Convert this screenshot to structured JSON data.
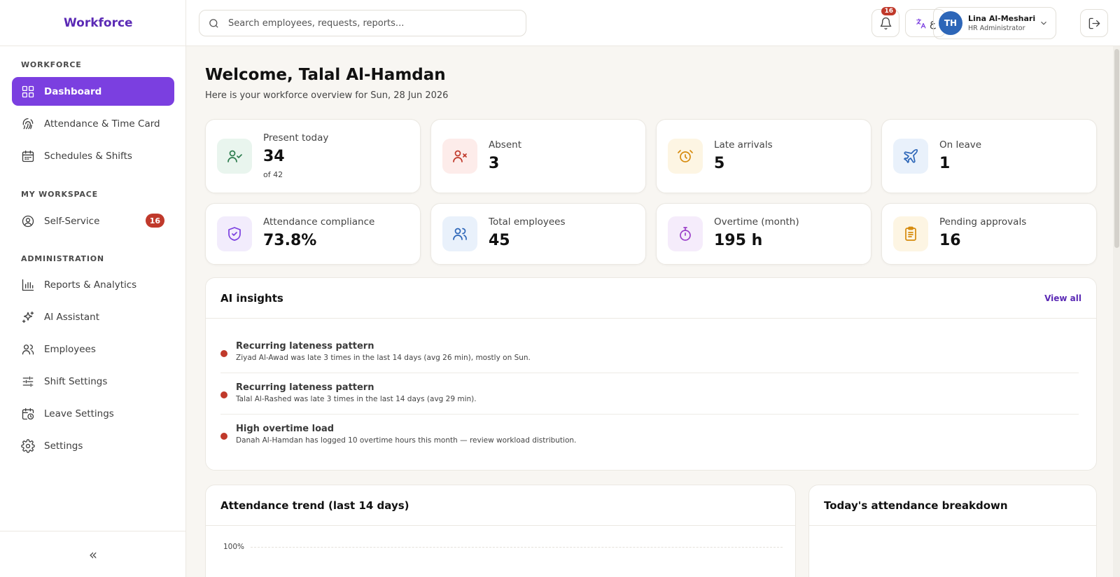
{
  "app": {
    "brand": "Workforce"
  },
  "sidebar": {
    "sections": [
      {
        "title": "WORKFORCE"
      },
      {
        "title": "MY WORKSPACE"
      },
      {
        "title": "ADMINISTRATION"
      }
    ],
    "items": [
      {
        "label": "Dashboard",
        "icon": "dashboard-grid-icon",
        "active": true
      },
      {
        "label": "Attendance & Time Card",
        "icon": "fingerprint-icon"
      },
      {
        "label": "Schedules & Shifts",
        "icon": "calendar-icon"
      },
      {
        "label": "Self-Service",
        "icon": "user-circle-icon",
        "badge": "16"
      },
      {
        "label": "Reports & Analytics",
        "icon": "bar-chart-icon"
      },
      {
        "label": "AI Assistant",
        "icon": "sparkles-icon"
      },
      {
        "label": "Employees",
        "icon": "users-icon"
      },
      {
        "label": "Shift Settings",
        "icon": "sliders-icon"
      },
      {
        "label": "Leave Settings",
        "icon": "calendar-clock-icon"
      },
      {
        "label": "Settings",
        "icon": "gear-icon"
      }
    ],
    "collapse_label": "«"
  },
  "topbar": {
    "search_placeholder": "Search employees, requests, reports...",
    "notifications_count": "16",
    "language_label": "ع",
    "user": {
      "initials": "TH",
      "name": "Lina Al-Meshari",
      "role": "HR Administrator"
    }
  },
  "main": {
    "welcome": "Welcome, Talal Al-Hamdan",
    "subtitle": "Here is your workforce overview for Sun, 28 Jun 2026",
    "stats": [
      {
        "label": "Present today",
        "value": "34",
        "sub": "of 42",
        "icon": "user-check-icon",
        "color": "#2e7d4f",
        "bg": "#e9f5ee"
      },
      {
        "label": "Absent",
        "value": "3",
        "icon": "user-x-icon",
        "color": "#c0392b",
        "bg": "#fdecea"
      },
      {
        "label": "Late arrivals",
        "value": "5",
        "icon": "alarm-clock-icon",
        "color": "#d68a0c",
        "bg": "#fdf5e3"
      },
      {
        "label": "On leave",
        "value": "1",
        "icon": "plane-icon",
        "color": "#2d66b8",
        "bg": "#e9f1fb"
      },
      {
        "label": "Attendance compliance",
        "value": "73.8%",
        "icon": "shield-check-icon",
        "color": "#7b3fe0",
        "bg": "#f2ecfc"
      },
      {
        "label": "Total employees",
        "value": "45",
        "icon": "users-icon",
        "color": "#2d66b8",
        "bg": "#e9f1fb"
      },
      {
        "label": "Overtime (month)",
        "value": "195 h",
        "icon": "stopwatch-icon",
        "color": "#9b3fc9",
        "bg": "#f5ecfb"
      },
      {
        "label": "Pending approvals",
        "value": "16",
        "icon": "clipboard-icon",
        "color": "#d68a0c",
        "bg": "#fdf5e3"
      }
    ],
    "insights": {
      "title": "AI insights",
      "view_all": "View all",
      "items": [
        {
          "title": "Recurring lateness pattern",
          "desc": "Ziyad Al-Awad was late 3 times in the last 14 days (avg 26 min), mostly on Sun."
        },
        {
          "title": "Recurring lateness pattern",
          "desc": "Talal Al-Rashed was late 3 times in the last 14 days (avg 29 min)."
        },
        {
          "title": "High overtime load",
          "desc": "Danah Al-Hamdan has logged 10 overtime hours this month — review workload distribution."
        }
      ]
    },
    "trend": {
      "title": "Attendance trend (last 14 days)",
      "y_tick_top": "100%"
    },
    "breakdown": {
      "title": "Today's attendance breakdown"
    }
  }
}
